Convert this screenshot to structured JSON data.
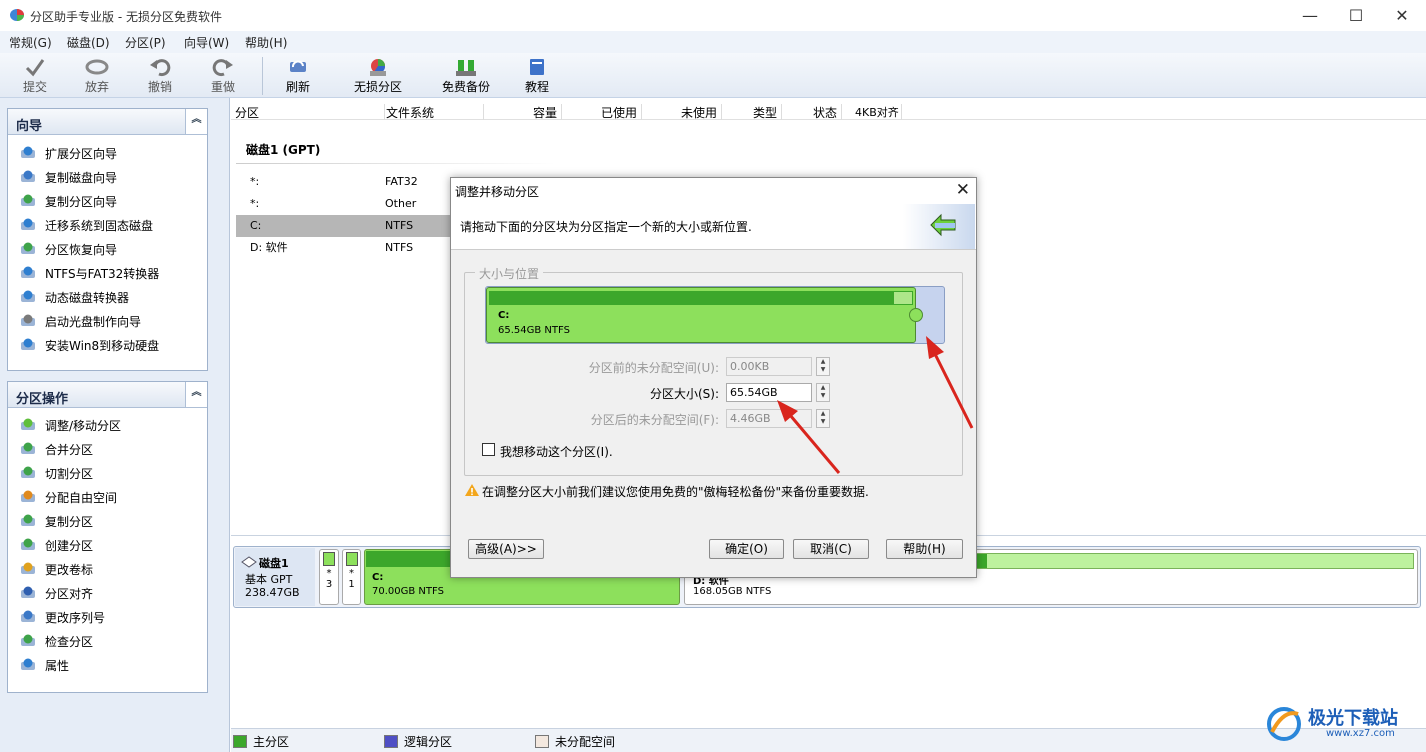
{
  "window": {
    "title": "分区助手专业版 - 无损分区免费软件"
  },
  "menu": [
    "常规(G)",
    "磁盘(D)",
    "分区(P)",
    "向导(W)",
    "帮助(H)"
  ],
  "toolbar": {
    "commit": "提交",
    "discard": "放弃",
    "undo": "撤销",
    "redo": "重做",
    "refresh": "刷新",
    "lossless": "无损分区",
    "backup": "免费备份",
    "tutorial": "教程"
  },
  "wizard_panel": {
    "title": "向导",
    "items": [
      "扩展分区向导",
      "复制磁盘向导",
      "复制分区向导",
      "迁移系统到固态磁盘",
      "分区恢复向导",
      "NTFS与FAT32转换器",
      "动态磁盘转换器",
      "启动光盘制作向导",
      "安装Win8到移动硬盘"
    ]
  },
  "ops_panel": {
    "title": "分区操作",
    "items": [
      "调整/移动分区",
      "合并分区",
      "切割分区",
      "分配自由空间",
      "复制分区",
      "创建分区",
      "更改卷标",
      "分区对齐",
      "更改序列号",
      "检查分区",
      "属性"
    ]
  },
  "columns": [
    "分区",
    "文件系统",
    "容量",
    "已使用",
    "未使用",
    "类型",
    "状态",
    "4KB对齐"
  ],
  "disk_label": "磁盘1 (GPT)",
  "partitions": [
    {
      "name": "*:",
      "fs": "FAT32"
    },
    {
      "name": "*:",
      "fs": "Other"
    },
    {
      "name": "C:",
      "fs": "NTFS"
    },
    {
      "name": "D: 软件",
      "fs": "NTFS"
    }
  ],
  "diskmap": {
    "disk_name": "磁盘1",
    "disk_type": "基本 GPT",
    "disk_size": "238.47GB",
    "small1_top": "*",
    "small1_bottom": "3",
    "small2_top": "*",
    "small2_bottom": "1",
    "c_name": "C:",
    "c_info": "70.00GB NTFS",
    "d_name": "D: 软件",
    "d_info": "168.05GB NTFS"
  },
  "legend": {
    "primary": "主分区",
    "logical": "逻辑分区",
    "unalloc": "未分配空间"
  },
  "dialog": {
    "title": "调整并移动分区",
    "instruction": "请拖动下面的分区块为分区指定一个新的大小或新位置.",
    "group_label": "大小与位置",
    "part_name": "C:",
    "part_info": "65.54GB NTFS",
    "before_label": "分区前的未分配空间(U):",
    "before_value": "0.00KB",
    "size_label": "分区大小(S):",
    "size_value": "65.54GB",
    "after_label": "分区后的未分配空间(F):",
    "after_value": "4.46GB",
    "move_checkbox": "我想移动这个分区(I).",
    "warning": "在调整分区大小前我们建议您使用免费的\"傲梅轻松备份\"来备份重要数据.",
    "advanced": "高级(A)>>",
    "ok": "确定(O)",
    "cancel": "取消(C)",
    "help": "帮助(H)"
  },
  "watermark": {
    "cn": "极光下载站",
    "url": "www.xz7.com"
  },
  "colors": {
    "primary_green": "#8de05c",
    "arrow_red": "#d9251d",
    "logical_blue": "#4f4fc4"
  }
}
